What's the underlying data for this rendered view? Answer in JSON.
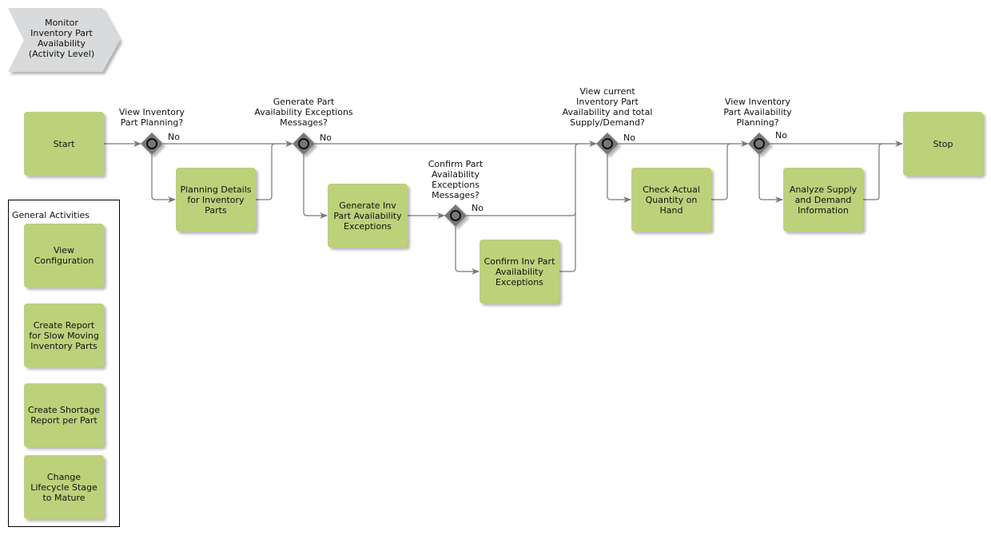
{
  "header": {
    "title": "Monitor\nInventory Part\nAvailability\n(Activity Level)"
  },
  "colors": {
    "activity_fill": "#bdd17a",
    "gateway_fill": "#777777",
    "header_fill": "#d9dadb",
    "connector": "#777777"
  },
  "flow": {
    "start": "Start",
    "stop": "Stop",
    "no_label": "No",
    "gateways": [
      {
        "id": "g1",
        "label": "View Inventory\nPart Planning?"
      },
      {
        "id": "g2",
        "label": "Generate Part\nAvailability Exceptions\nMessages?"
      },
      {
        "id": "g3",
        "label": "Confirm Part\nAvailability\nExceptions\nMessages?"
      },
      {
        "id": "g4",
        "label": "View current\nInventory Part\nAvailability and total\nSupply/Demand?"
      },
      {
        "id": "g5",
        "label": "View Inventory\nPart Availability\nPlanning?"
      }
    ],
    "activities": [
      {
        "id": "a1",
        "label": "Planning Details\nfor Inventory\nParts"
      },
      {
        "id": "a2",
        "label": "Generate Inv\nPart Availability\nExceptions"
      },
      {
        "id": "a3",
        "label": "Confirm Inv Part\nAvailability\nExceptions"
      },
      {
        "id": "a4",
        "label": "Check Actual\nQuantity on\nHand"
      },
      {
        "id": "a5",
        "label": "Analyze Supply\nand Demand\nInformation"
      }
    ]
  },
  "general_activities": {
    "title": "General Activities",
    "items": [
      {
        "label": "View\nConfiguration"
      },
      {
        "label": "Create Report\nfor Slow Moving\nInventory Parts"
      },
      {
        "label": "Create Shortage\nReport per Part"
      },
      {
        "label": "Change\nLifecycle Stage\nto Mature"
      }
    ]
  }
}
